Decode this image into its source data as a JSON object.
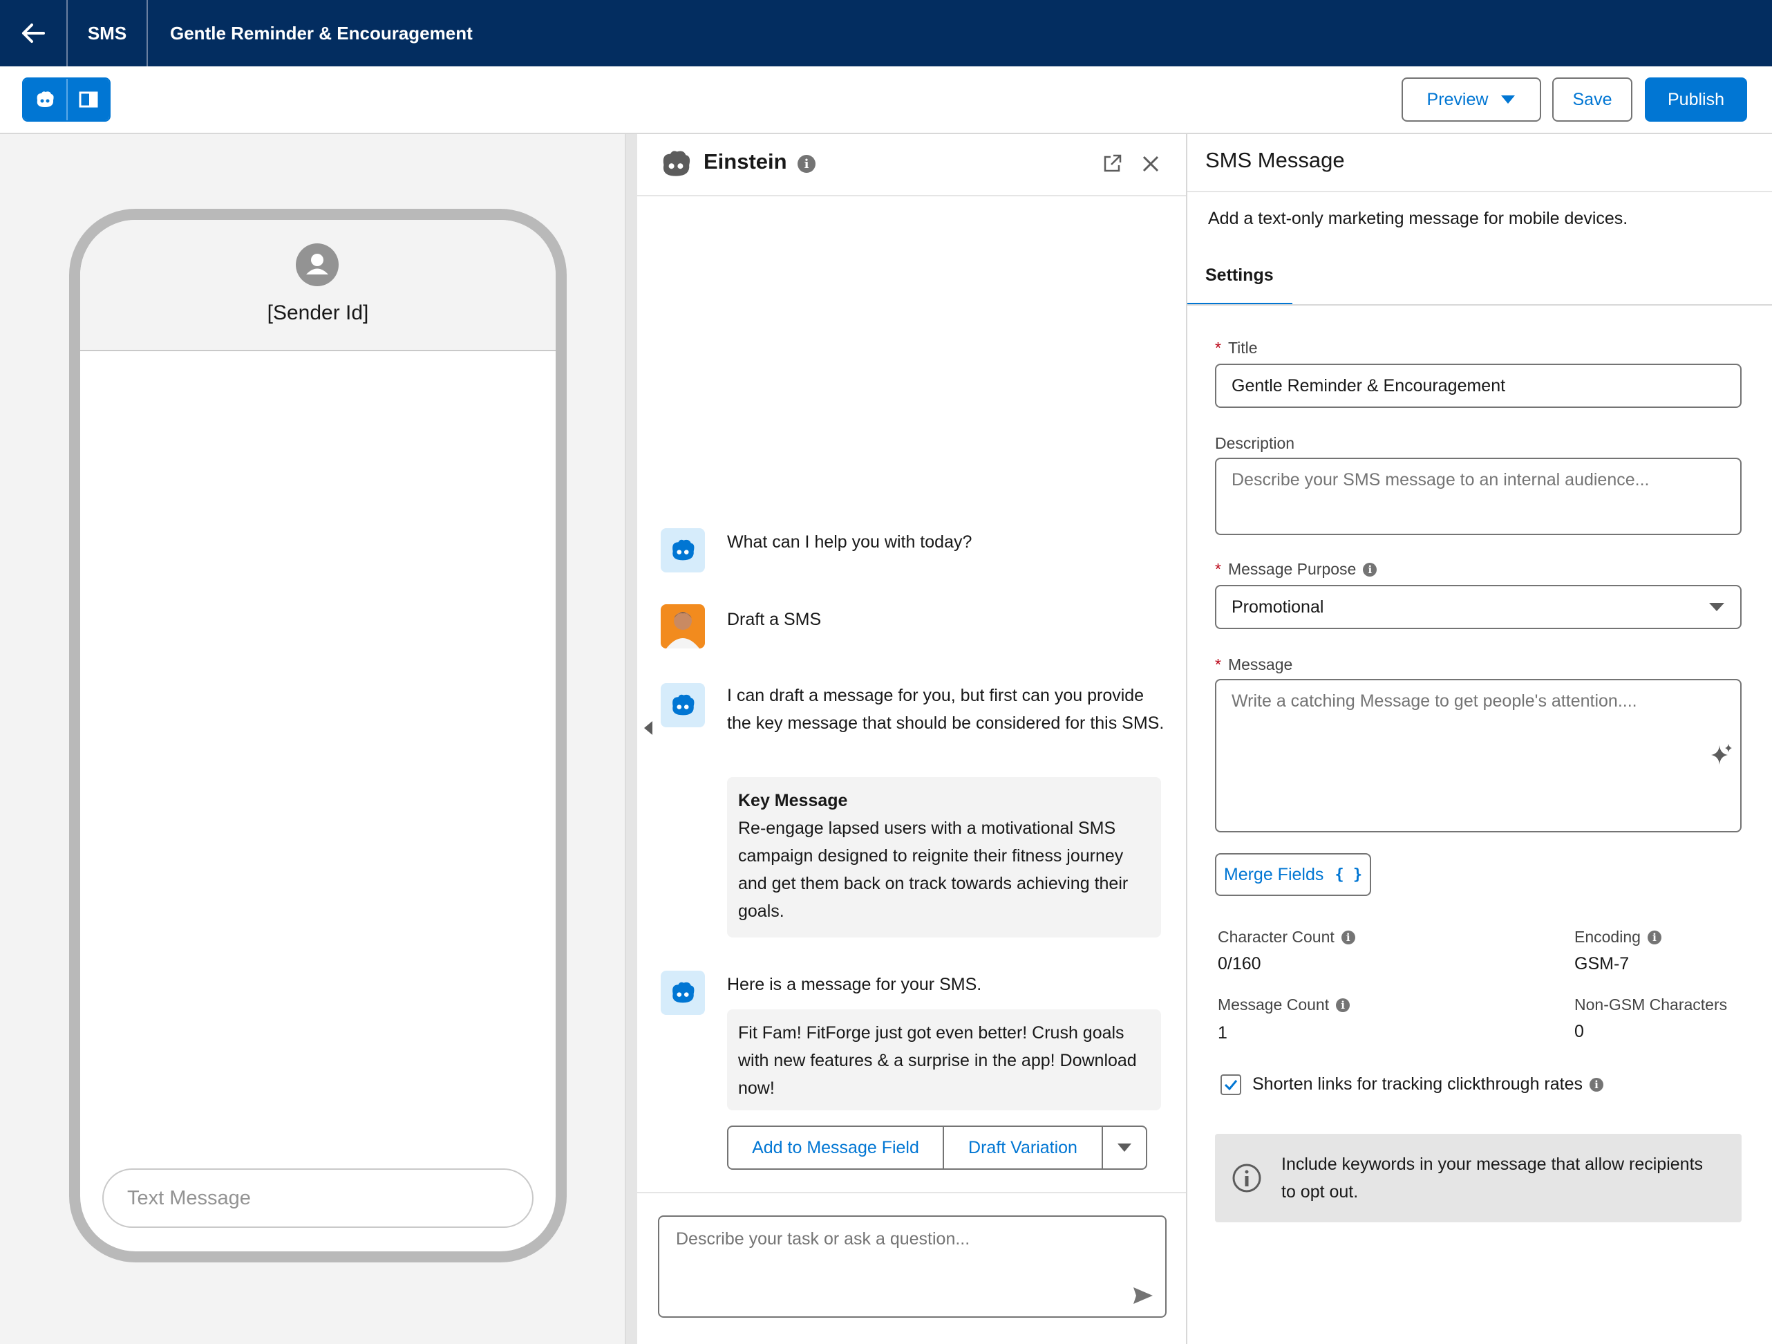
{
  "header": {
    "section": "SMS",
    "title": "Gentle Reminder & Encouragement"
  },
  "toolbar": {
    "preview_label": "Preview",
    "save_label": "Save",
    "publish_label": "Publish"
  },
  "phone": {
    "sender": "[Sender Id]",
    "text_placeholder": "Text Message"
  },
  "einstein": {
    "title": "Einstein",
    "messages": [
      {
        "from": "bot",
        "text": "What can I help you with today?"
      },
      {
        "from": "user",
        "text": "Draft a SMS"
      },
      {
        "from": "bot",
        "text": "I can draft a message for you, but first can you provide the key message that should be considered for this SMS."
      },
      {
        "from": "bot",
        "text": "Here is a message for your SMS."
      }
    ],
    "key_message": {
      "title": "Key Message",
      "body": "Re-engage lapsed users with a motivational SMS campaign designed to reignite their fitness journey and get them back on track towards achieving their goals."
    },
    "draft": "Fit Fam! FitForge just got even better! Crush goals with new features & a surprise in the app! Download now!",
    "actions": {
      "add": "Add to Message Field",
      "variation": "Draft Variation"
    },
    "input_placeholder": "Describe your task or ask a question..."
  },
  "props": {
    "title": "SMS Message",
    "subtitle": "Add a text-only marketing message for mobile devices.",
    "tab": "Settings",
    "title_label": "Title",
    "title_value": "Gentle Reminder & Encouragement",
    "description_label": "Description",
    "description_placeholder": "Describe your SMS message to an internal audience...",
    "purpose_label": "Message Purpose",
    "purpose_value": "Promotional",
    "message_label": "Message",
    "message_placeholder": "Write a catching Message to get people's attention....",
    "merge_fields": "Merge Fields",
    "char_count_label": "Character Count",
    "char_count": "0/160",
    "encoding_label": "Encoding",
    "encoding": "GSM-7",
    "msg_count_label": "Message Count",
    "msg_count": "1",
    "nongsm_label": "Non-GSM Characters",
    "nongsm": "0",
    "shorten_label": "Shorten links for tracking clickthrough rates",
    "shorten_checked": true,
    "notice": "Include keywords in your message that allow recipients to opt out."
  },
  "colors": {
    "nav": "#032d60",
    "brand": "#0176d3",
    "bot_bg": "#d6ecfb"
  }
}
